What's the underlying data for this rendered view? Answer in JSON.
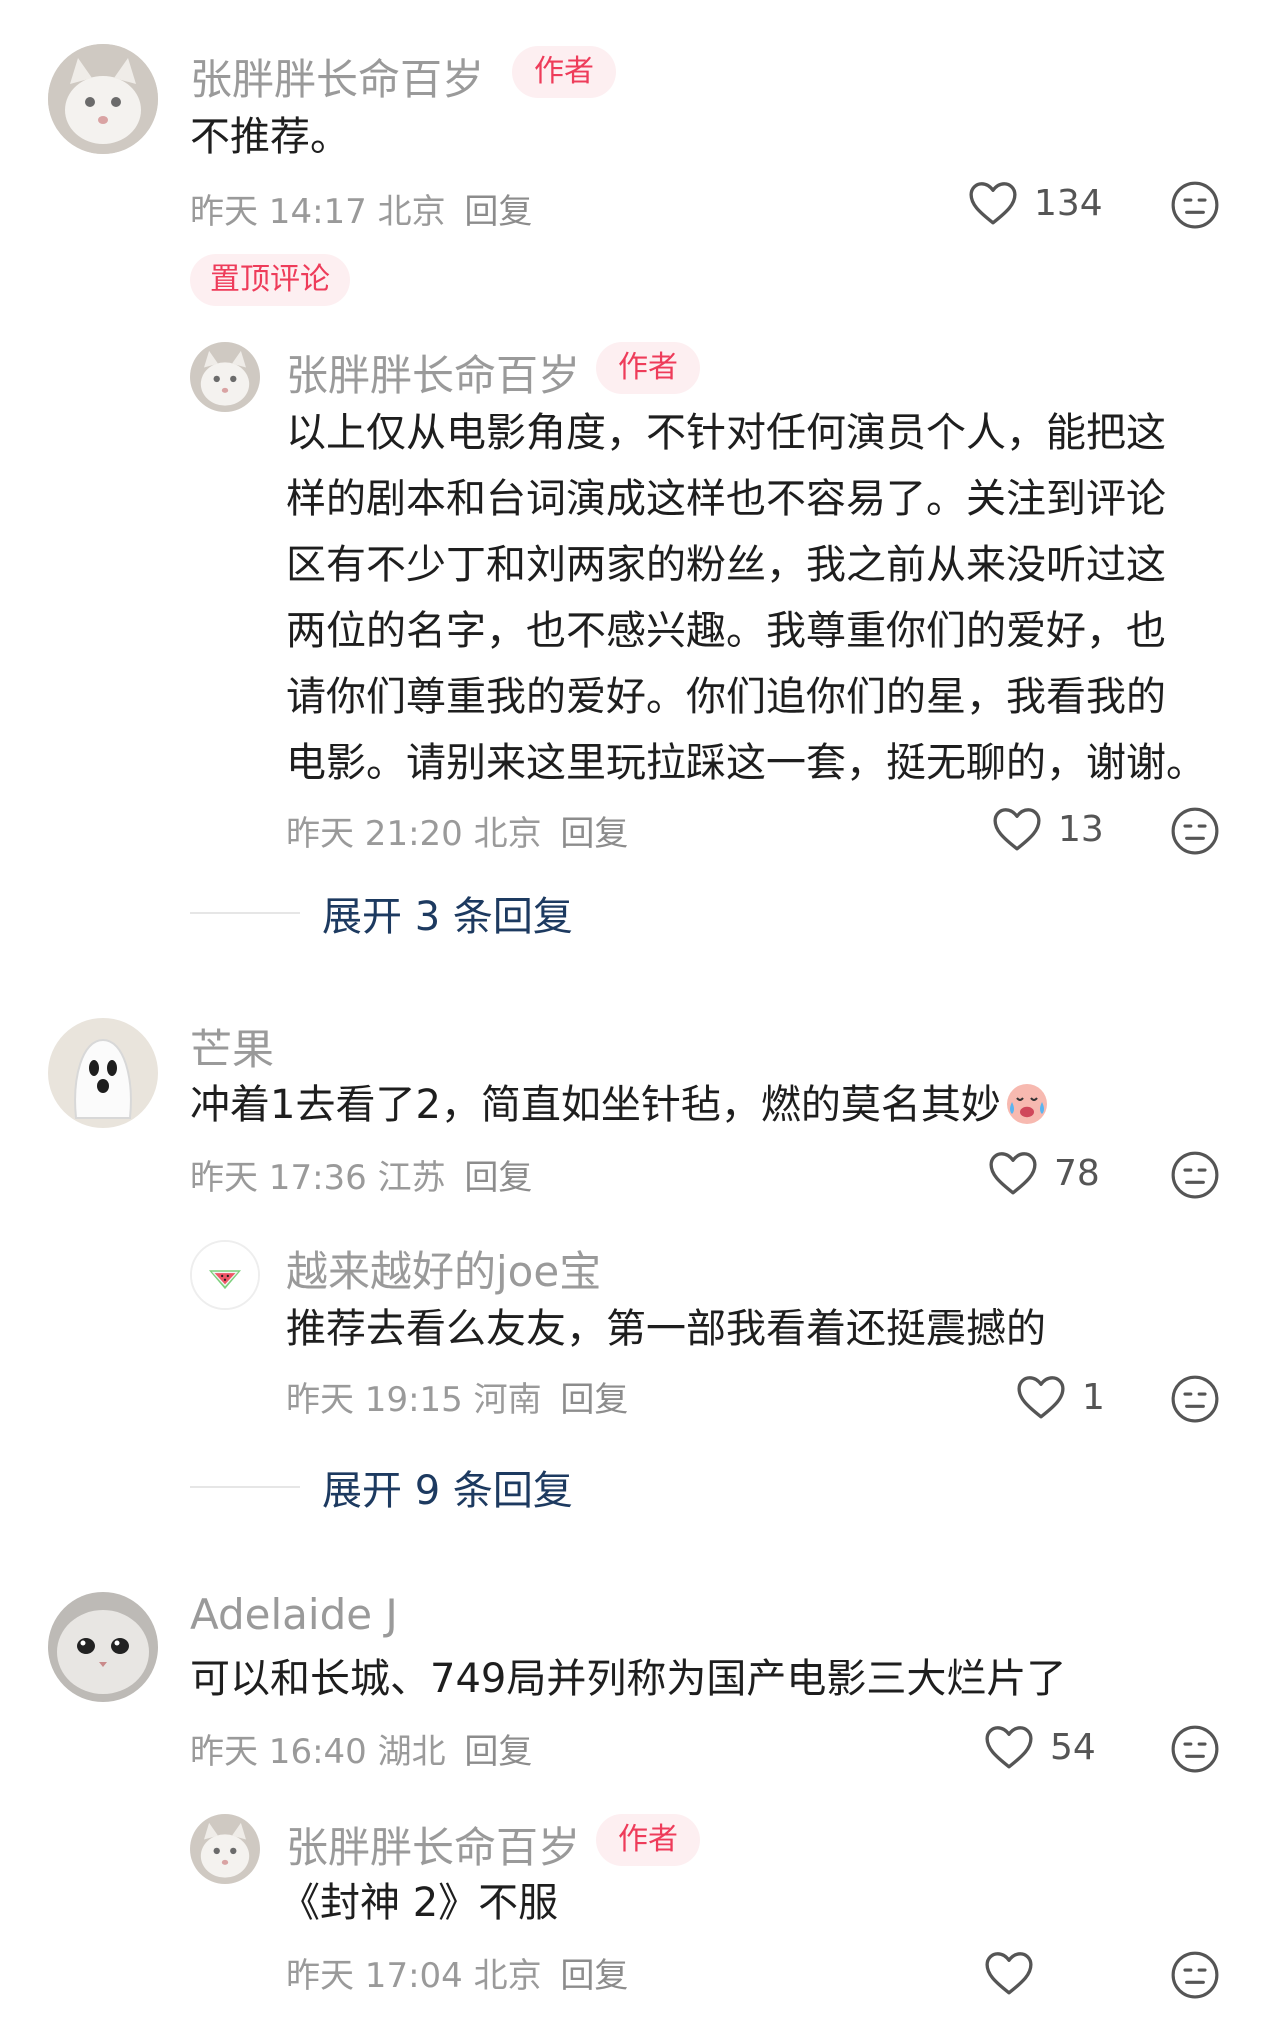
{
  "comments": [
    {
      "author": "张胖胖长命百岁",
      "badge": "作者",
      "text": "不推荐。",
      "meta": "昨天 14:17 北京",
      "reply": "回复",
      "likes": "134",
      "pinned_label": "置顶评论",
      "replies": [
        {
          "author": "张胖胖长命百岁",
          "badge": "作者",
          "lines": [
            "以上仅从电影角度，不针对任何演员个人，能把这",
            "样的剧本和台词演成这样也不容易了。关注到评论",
            "区有不少丁和刘两家的粉丝，我之前从来没听过这",
            "两位的名字，也不感兴趣。我尊重你们的爱好，也",
            "请你们尊重我的爱好。你们追你们的星，我看我的",
            "电影。请别来这里玩拉踩这一套，挺无聊的，谢谢。"
          ],
          "meta": "昨天 21:20 北京",
          "reply": "回复",
          "likes": "13"
        }
      ],
      "expand_label": "展开 3 条回复"
    },
    {
      "author": "芒果",
      "text": "冲着1去看了2，简直如坐针毡，燃的莫名其妙",
      "emoji": "crying-face-emoji",
      "meta": "昨天 17:36 江苏",
      "reply": "回复",
      "likes": "78",
      "replies": [
        {
          "author": "越来越好的joe宝",
          "text": "推荐去看么友友，第一部我看着还挺震撼的",
          "meta": "昨天 19:15 河南",
          "reply": "回复",
          "likes": "1"
        }
      ],
      "expand_label": "展开 9 条回复"
    },
    {
      "author": "Adelaide J",
      "text": "可以和长城、749局并列称为国产电影三大烂片了",
      "meta": "昨天 16:40 湖北",
      "reply": "回复",
      "likes": "54",
      "replies": [
        {
          "author": "张胖胖长命百岁",
          "badge": "作者",
          "text": "《封神 2》不服",
          "meta": "昨天 17:04 北京",
          "reply": "回复"
        }
      ]
    }
  ],
  "colors": {
    "accent_red": "#ee3c5a",
    "badge_bg": "#fdeff1",
    "expand_blue": "#1d3a60",
    "meta_gray": "#9a9a9a"
  }
}
